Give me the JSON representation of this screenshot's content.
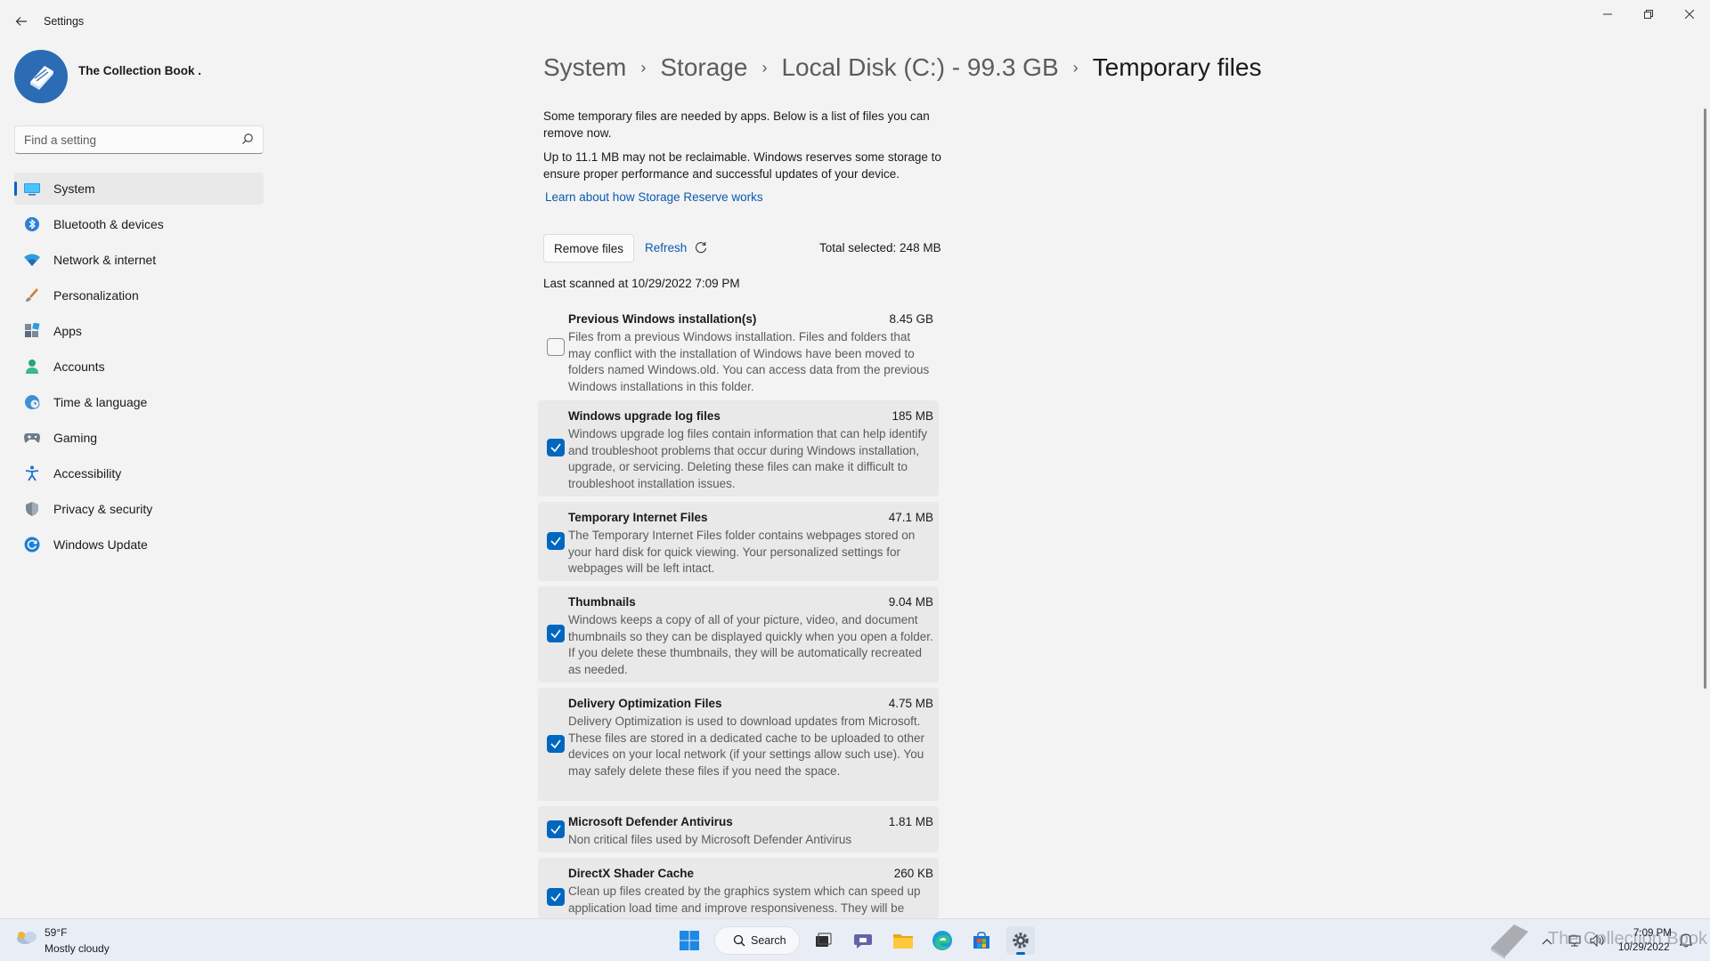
{
  "window": {
    "title": "Settings"
  },
  "profile": {
    "name": "The Collection Book ."
  },
  "search": {
    "placeholder": "Find a setting"
  },
  "nav": {
    "items": [
      {
        "label": "System",
        "icon": "monitor-icon"
      },
      {
        "label": "Bluetooth & devices",
        "icon": "bluetooth-icon"
      },
      {
        "label": "Network & internet",
        "icon": "wifi-icon"
      },
      {
        "label": "Personalization",
        "icon": "brush-icon"
      },
      {
        "label": "Apps",
        "icon": "apps-icon"
      },
      {
        "label": "Accounts",
        "icon": "person-icon"
      },
      {
        "label": "Time & language",
        "icon": "globe-clock-icon"
      },
      {
        "label": "Gaming",
        "icon": "gamepad-icon"
      },
      {
        "label": "Accessibility",
        "icon": "accessibility-icon"
      },
      {
        "label": "Privacy & security",
        "icon": "shield-icon"
      },
      {
        "label": "Windows Update",
        "icon": "update-icon"
      }
    ],
    "selected": "System"
  },
  "breadcrumb": {
    "items": [
      "System",
      "Storage",
      "Local Disk (C:) - 99.3 GB",
      "Temporary files"
    ]
  },
  "content": {
    "intro": "Some temporary files are needed by apps. Below is a list of files you can remove now.",
    "reserve_note": "Up to 11.1 MB may not be reclaimable. Windows reserves some storage to ensure proper performance and successful updates of your device.",
    "learn_link": "Learn about how Storage Reserve works",
    "remove_button": "Remove files",
    "refresh_label": "Refresh",
    "total_selected": "Total selected: 248 MB",
    "last_scanned": "Last scanned at 10/29/2022 7:09 PM"
  },
  "files": [
    {
      "title": "Previous Windows installation(s)",
      "size": "8.45 GB",
      "checked": false,
      "desc": "Files from a previous Windows installation.  Files and folders that may conflict with the installation of Windows have been moved to folders named Windows.old.  You can access data from the previous Windows installations in this folder."
    },
    {
      "title": "Windows upgrade log files",
      "size": "185 MB",
      "checked": true,
      "desc": "Windows upgrade log files contain information that can help identify and troubleshoot problems that occur during Windows installation, upgrade, or servicing.  Deleting these files can make it difficult to troubleshoot installation issues."
    },
    {
      "title": "Temporary Internet Files",
      "size": "47.1 MB",
      "checked": true,
      "desc": "The Temporary Internet Files folder contains webpages stored on your hard disk for quick viewing. Your personalized settings for webpages will be left intact."
    },
    {
      "title": "Thumbnails",
      "size": "9.04 MB",
      "checked": true,
      "desc": "Windows keeps a copy of all of your picture, video, and document thumbnails so they can be displayed quickly when you open a folder. If you delete these thumbnails, they will be automatically recreated as needed."
    },
    {
      "title": "Delivery Optimization Files",
      "size": "4.75 MB",
      "checked": true,
      "desc": "Delivery Optimization is used to download updates from Microsoft. These files are stored in a dedicated cache to be uploaded to other devices on your local network (if your settings allow such use). You may safely delete these files if you need the space."
    },
    {
      "title": "Microsoft Defender Antivirus",
      "size": "1.81 MB",
      "checked": true,
      "desc": "Non critical files used by Microsoft Defender Antivirus"
    },
    {
      "title": "DirectX Shader Cache",
      "size": "260 KB",
      "checked": true,
      "desc": "Clean up files created by the graphics system which can speed up application load time and improve responsiveness. They will be"
    }
  ],
  "taskbar": {
    "weather_temp": "59°F",
    "weather_desc": "Mostly cloudy",
    "search_label": "Search",
    "time": "7:09 PM",
    "date": "10/29/2022",
    "watermark": "The Collection Book"
  },
  "colors": {
    "accent": "#0067c0",
    "link": "#0a5ab0",
    "background": "#f3f3f3",
    "card": "#e9e9e9"
  }
}
